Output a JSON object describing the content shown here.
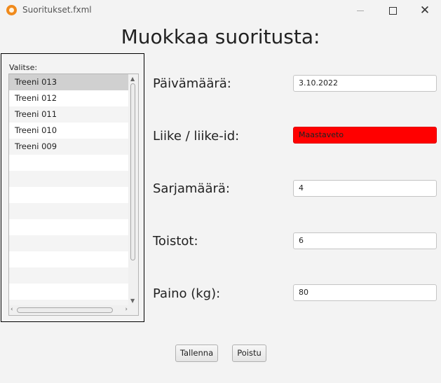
{
  "window": {
    "title": "Suoritukset.fxml"
  },
  "heading": "Muokkaa suoritusta:",
  "list": {
    "label": "Valitse:",
    "items": [
      "Treeni 013",
      "Treeni 012",
      "Treeni 011",
      "Treeni 010",
      "Treeni 009"
    ],
    "selected": "Treeni 013"
  },
  "form": {
    "date_label": "Päivämäärä:",
    "date_value": "3.10.2022",
    "move_label": "Liike / liike-id:",
    "move_value": "Maastaveto",
    "sets_label": "Sarjamäärä:",
    "sets_value": "4",
    "reps_label": "Toistot:",
    "reps_value": "6",
    "weight_label": "Paino (kg):",
    "weight_value": "80"
  },
  "buttons": {
    "save": "Tallenna",
    "delete": "Poistu"
  },
  "colors": {
    "error_field": "#ff0000",
    "selection": "#d0d0d0"
  }
}
